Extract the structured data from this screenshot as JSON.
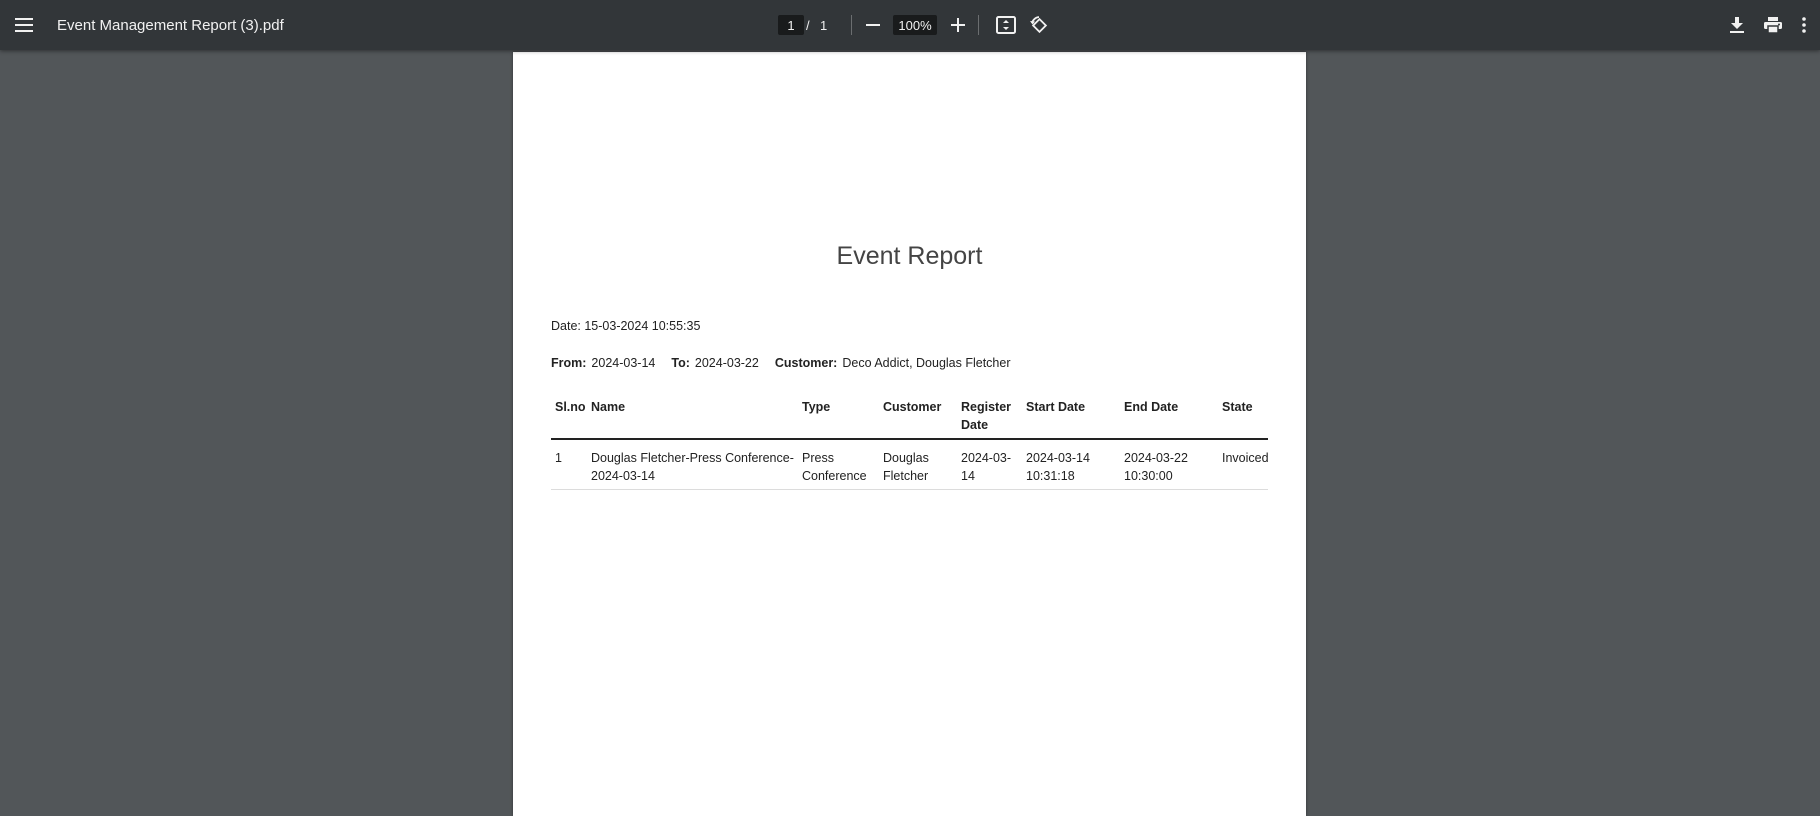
{
  "toolbar": {
    "menu_icon": "hamburger-menu-icon",
    "file_title": "Event Management Report (3).pdf",
    "current_page": "1",
    "page_separator": "/",
    "total_pages": "1",
    "zoom_level": "100%",
    "icons": {
      "zoom_out": "minus-icon",
      "zoom_in": "plus-icon",
      "fit_page": "fit-to-page-icon",
      "rotate": "rotate-icon",
      "download": "download-icon",
      "print": "print-icon",
      "more": "more-vertical-icon"
    }
  },
  "report": {
    "title": "Event Report",
    "date_line": "Date: 15-03-2024 10:55:35",
    "filters": {
      "from_label": "From:",
      "from_value": "2024-03-14",
      "to_label": "To:",
      "to_value": "2024-03-22",
      "customer_label": "Customer:",
      "customer_value": "Deco Addict, Douglas Fletcher"
    },
    "table": {
      "headers": [
        "Sl.no",
        "Name",
        "Type",
        "Customer",
        "Register Date",
        "Start Date",
        "End Date",
        "State"
      ],
      "rows": [
        [
          "1",
          "Douglas Fletcher-Press Conference-2024-03-14",
          "Press Conference",
          "Douglas Fletcher",
          "2024-03-14",
          "2024-03-14 10:31:18",
          "2024-03-22 10:30:00",
          "Invoiced"
        ]
      ]
    }
  }
}
